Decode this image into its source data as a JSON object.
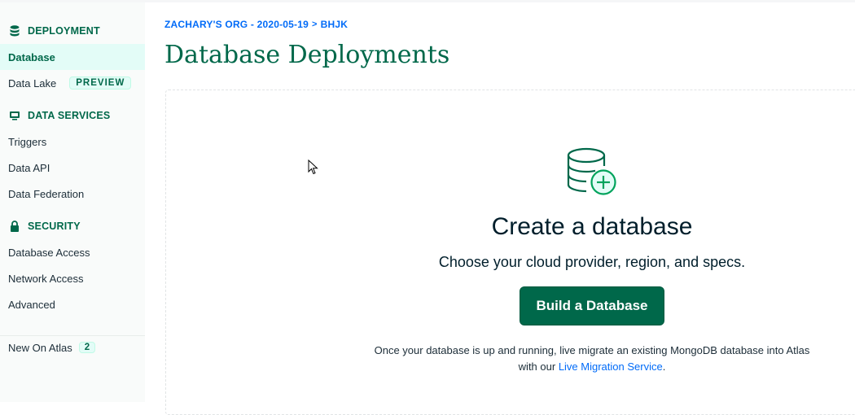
{
  "sidebar": {
    "deployment_head": "DEPLOYMENT",
    "database": "Database",
    "data_lake": "Data Lake",
    "data_lake_badge": "PREVIEW",
    "data_services_head": "DATA SERVICES",
    "triggers": "Triggers",
    "data_api": "Data API",
    "data_federation": "Data Federation",
    "security_head": "SECURITY",
    "database_access": "Database Access",
    "network_access": "Network Access",
    "advanced": "Advanced",
    "new_on_atlas": "New On Atlas",
    "new_on_atlas_count": "2"
  },
  "breadcrumb": {
    "org": "ZACHARY'S ORG - 2020-05-19",
    "separator": ">",
    "project": "BHJK"
  },
  "page_title": "Database Deployments",
  "empty_state": {
    "title": "Create a database",
    "subtitle": "Choose your cloud provider, region, and specs.",
    "button": "Build a Database",
    "footnote_text": "Once your database is up and running, live migrate an existing MongoDB database into Atlas with our ",
    "footnote_link": "Live Migration Service",
    "footnote_end": "."
  },
  "colors": {
    "brand_green": "#00684a",
    "link_blue": "#016bf8",
    "active_bg": "#e3fcf7"
  },
  "icons": {
    "deployment": "database-stack-icon",
    "data_services": "monitor-icon",
    "security": "lock-icon",
    "empty_state": "database-plus-icon"
  }
}
